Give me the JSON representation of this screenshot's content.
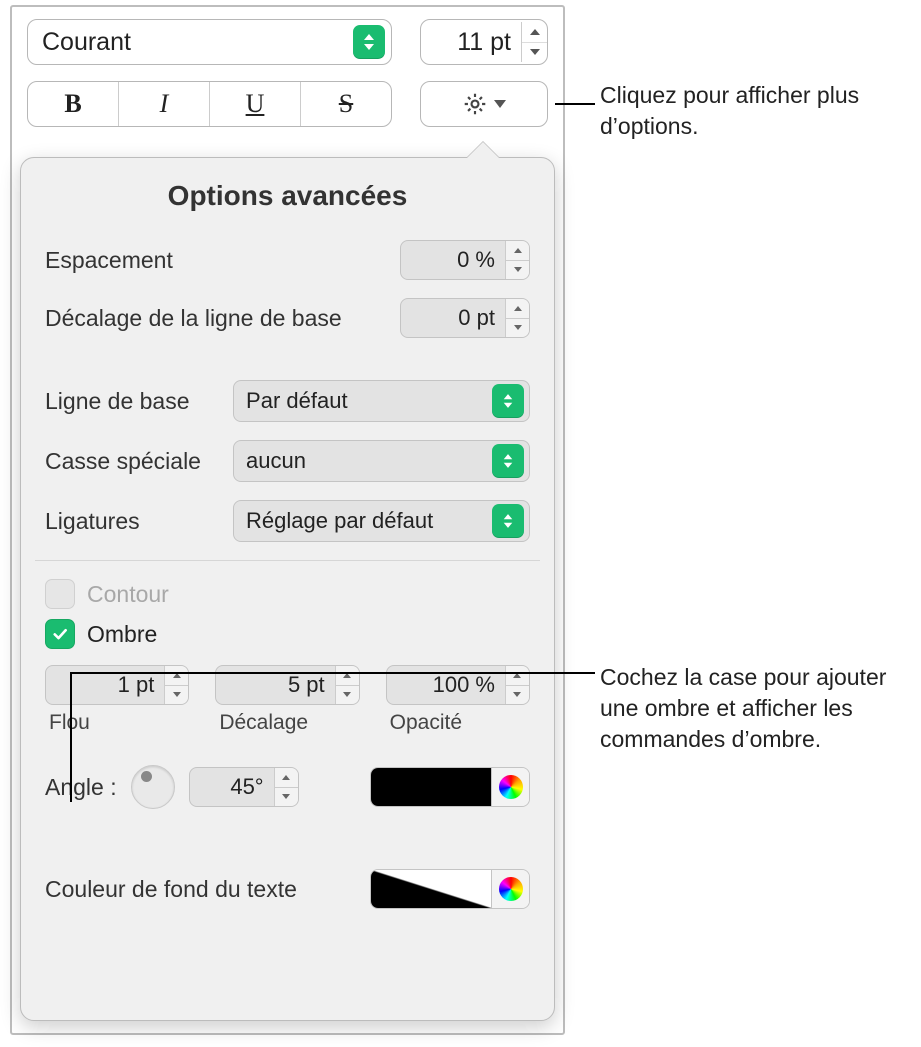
{
  "top": {
    "font": "Courant",
    "size": "11 pt"
  },
  "popover": {
    "title": "Options avancées",
    "spacing_label": "Espacement",
    "spacing_value": "0 %",
    "baseline_shift_label": "Décalage de la ligne de base",
    "baseline_shift_value": "0 pt",
    "baseline_label": "Ligne de base",
    "baseline_value": "Par défaut",
    "caps_label": "Casse spéciale",
    "caps_value": "aucun",
    "ligatures_label": "Ligatures",
    "ligatures_value": "Réglage par défaut",
    "outline_label": "Contour",
    "shadow_label": "Ombre",
    "blur": {
      "value": "1 pt",
      "label": "Flou"
    },
    "offset": {
      "value": "5 pt",
      "label": "Décalage"
    },
    "opacity": {
      "value": "100 %",
      "label": "Opacité"
    },
    "angle_label": "Angle :",
    "angle_value": "45°",
    "bgtext_label": "Couleur de fond du texte"
  },
  "callouts": {
    "gear": "Cliquez pour afficher plus d’options.",
    "shadow": "Cochez la case pour ajouter une ombre et afficher les commandes d’ombre."
  }
}
